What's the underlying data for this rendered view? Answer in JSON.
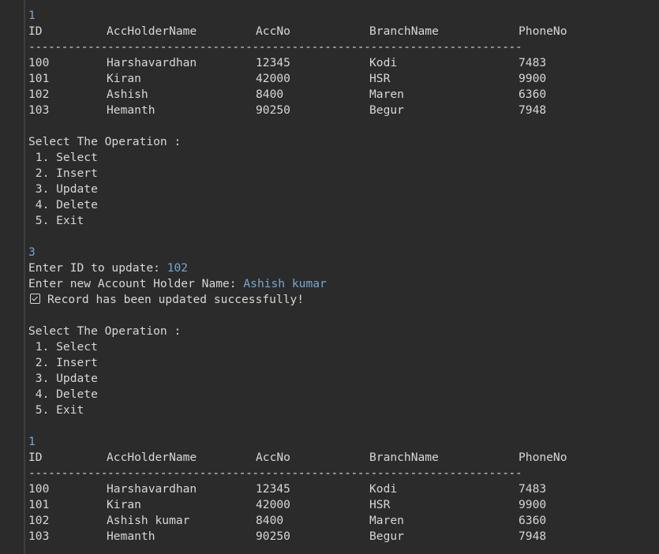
{
  "table_headers": {
    "id": "ID",
    "name": "AccHolderName",
    "accno": "AccNo",
    "branch": "BranchName",
    "phone": "PhoneNo"
  },
  "separator": "---------------------------------------------------------------------------",
  "block1": {
    "input_choice": "1",
    "rows": [
      {
        "id": "100",
        "name": "Harshavardhan",
        "accno": "12345",
        "branch": "Kodi",
        "phone": "7483"
      },
      {
        "id": "101",
        "name": "Kiran",
        "accno": "42000",
        "branch": "HSR",
        "phone": "9900"
      },
      {
        "id": "102",
        "name": "Ashish",
        "accno": "8400",
        "branch": "Maren",
        "phone": "6360"
      },
      {
        "id": "103",
        "name": "Hemanth",
        "accno": "90250",
        "branch": "Begur",
        "phone": "7948"
      }
    ]
  },
  "menu": {
    "title": "Select The Operation :",
    "items": [
      " 1. Select",
      " 2. Insert",
      " 3. Update",
      " 4. Delete",
      " 5. Exit"
    ]
  },
  "update": {
    "input_choice": "3",
    "id_prompt": "Enter ID to update: ",
    "id_value": "102",
    "name_prompt": "Enter new Account Holder Name: ",
    "name_value": "Ashish kumar",
    "success_msg": "Record has been updated successfully!"
  },
  "block2": {
    "input_choice": "1",
    "rows": [
      {
        "id": "100",
        "name": "Harshavardhan",
        "accno": "12345",
        "branch": "Kodi",
        "phone": "7483"
      },
      {
        "id": "101",
        "name": "Kiran",
        "accno": "42000",
        "branch": "HSR",
        "phone": "9900"
      },
      {
        "id": "102",
        "name": "Ashish kumar",
        "accno": "8400",
        "branch": "Maren",
        "phone": "6360"
      },
      {
        "id": "103",
        "name": "Hemanth",
        "accno": "90250",
        "branch": "Begur",
        "phone": "7948"
      }
    ]
  },
  "icons": {
    "success": "checkbox-checked-icon"
  },
  "colors": {
    "background": "#2b2b2b",
    "text": "#d7d7d7",
    "user_input": "#7aa7cf"
  }
}
